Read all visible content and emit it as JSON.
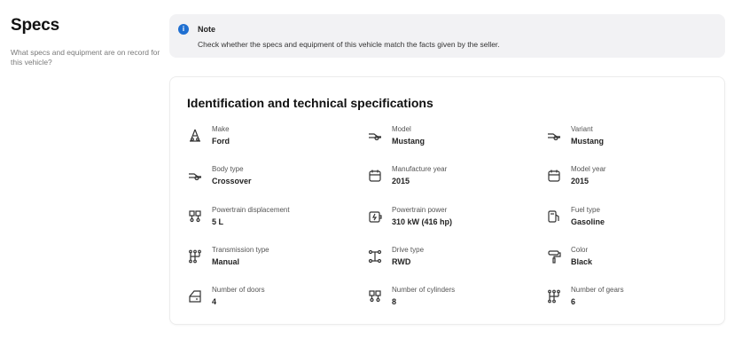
{
  "sidebar": {
    "title": "Specs",
    "description": "What specs and equipment are on record for this vehicle?"
  },
  "note": {
    "icon": "info-icon",
    "title": "Note",
    "text": "Check whether the specs and equipment of this vehicle match the facts given by the seller."
  },
  "specs": {
    "title": "Identification and technical specifications",
    "items": [
      {
        "icon": "car-tow-icon",
        "label": "Make",
        "value": "Ford"
      },
      {
        "icon": "car-icon",
        "label": "Model",
        "value": "Mustang"
      },
      {
        "icon": "car-icon",
        "label": "Variant",
        "value": "Mustang"
      },
      {
        "icon": "car-icon",
        "label": "Body type",
        "value": "Crossover"
      },
      {
        "icon": "calendar-icon",
        "label": "Manufacture year",
        "value": "2015"
      },
      {
        "icon": "calendar-icon",
        "label": "Model year",
        "value": "2015"
      },
      {
        "icon": "engine-icon",
        "label": "Powertrain displacement",
        "value": "5 L"
      },
      {
        "icon": "battery-power-icon",
        "label": "Powertrain power",
        "value": "310 kW (416 hp)"
      },
      {
        "icon": "fuel-pump-icon",
        "label": "Fuel type",
        "value": "Gasoline"
      },
      {
        "icon": "gear-shift-icon",
        "label": "Transmission type",
        "value": "Manual"
      },
      {
        "icon": "drivetrain-icon",
        "label": "Drive type",
        "value": "RWD"
      },
      {
        "icon": "paint-roller-icon",
        "label": "Color",
        "value": "Black"
      },
      {
        "icon": "car-door-icon",
        "label": "Number of doors",
        "value": "4"
      },
      {
        "icon": "engine-icon",
        "label": "Number of cylinders",
        "value": "8"
      },
      {
        "icon": "gear-shift-icon",
        "label": "Number of gears",
        "value": "6"
      }
    ]
  }
}
